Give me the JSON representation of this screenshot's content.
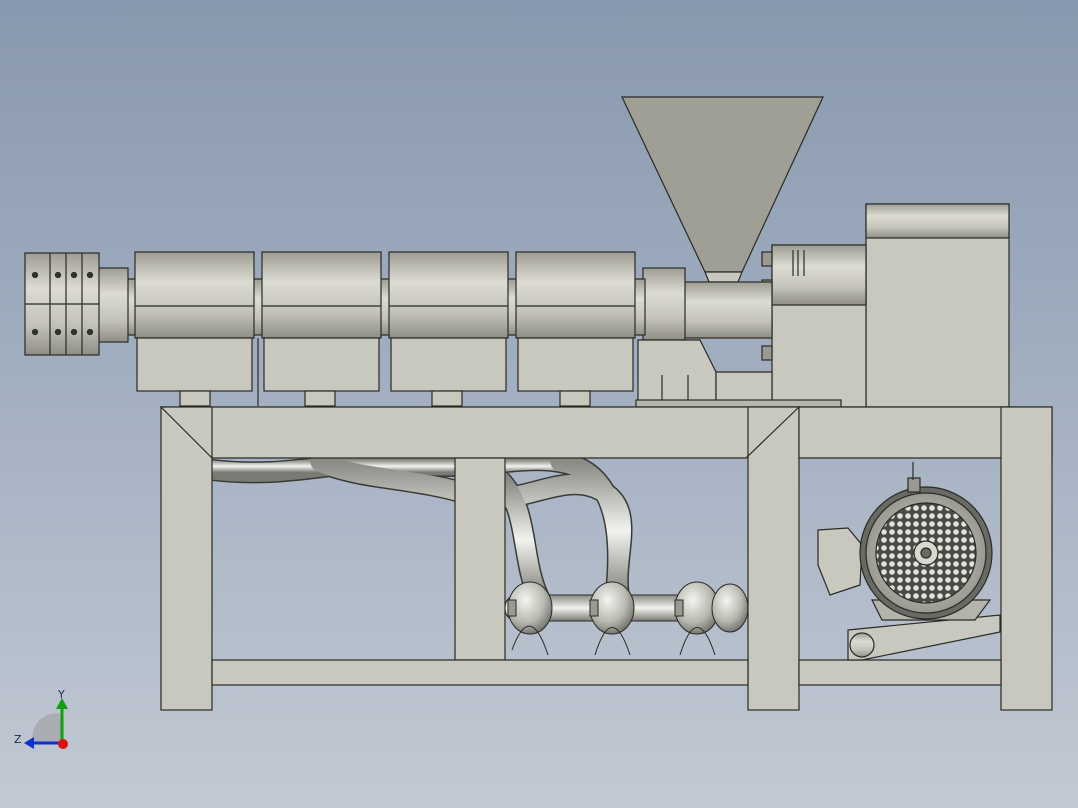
{
  "viewport": {
    "background_top": "#8898ae",
    "background_bottom": "#c2c9d3"
  },
  "colors": {
    "part_fill": "#c9c8be",
    "part_shade": "#a8a79d",
    "edge": "#2a2a26",
    "axis_x": "#e01010",
    "axis_y": "#10a010",
    "axis_z": "#1030d0"
  },
  "triad": {
    "y_label": "Y",
    "z_label": "Z"
  }
}
